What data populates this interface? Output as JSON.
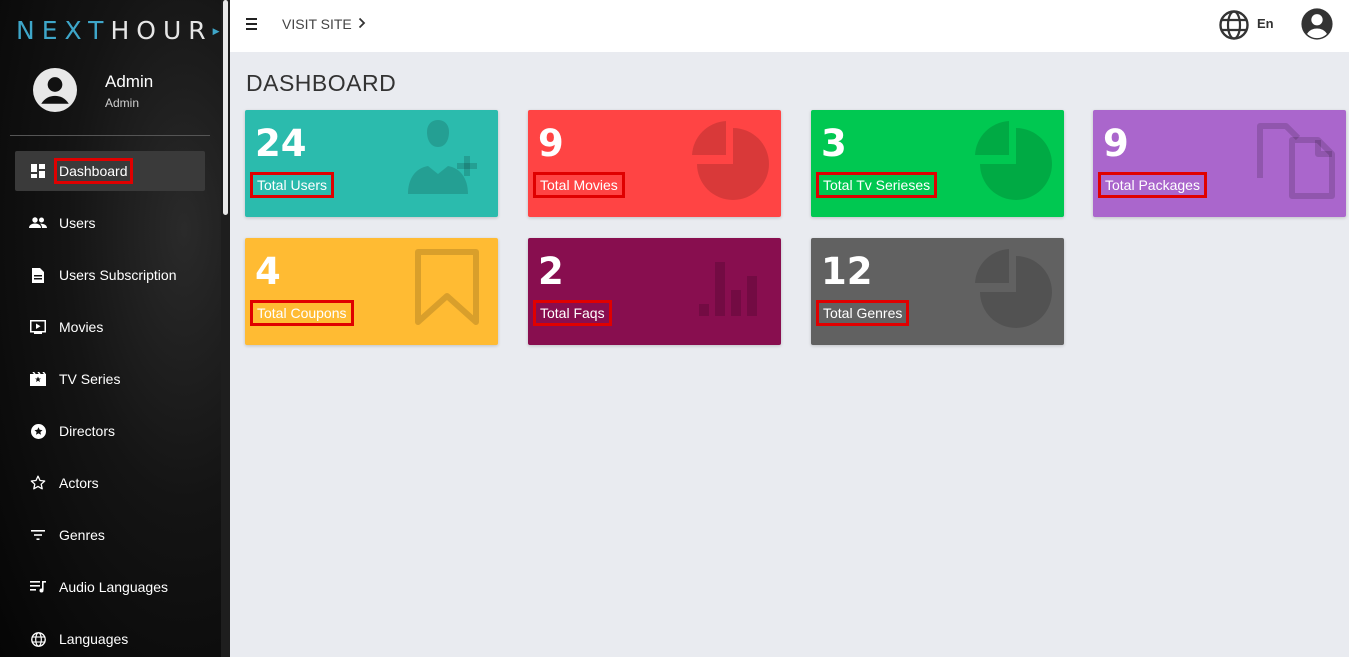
{
  "app": {
    "logo_left": "NEXT",
    "logo_right": "HOUR"
  },
  "profile": {
    "name": "Admin",
    "role": "Admin"
  },
  "sidebar": {
    "items": [
      {
        "label": "Dashboard",
        "icon": "dashboard-icon"
      },
      {
        "label": "Users",
        "icon": "users-icon"
      },
      {
        "label": "Users Subscription",
        "icon": "document-icon"
      },
      {
        "label": "Movies",
        "icon": "movie-icon"
      },
      {
        "label": "TV Series",
        "icon": "tv-series-icon"
      },
      {
        "label": "Directors",
        "icon": "director-star-icon"
      },
      {
        "label": "Actors",
        "icon": "star-outline-icon"
      },
      {
        "label": "Genres",
        "icon": "filter-icon"
      },
      {
        "label": "Audio Languages",
        "icon": "audio-list-icon"
      },
      {
        "label": "Languages",
        "icon": "globe-icon"
      }
    ]
  },
  "topbar": {
    "visit_site": "VISIT SITE",
    "language": "En"
  },
  "main": {
    "title": "DASHBOARD",
    "cards": [
      {
        "value": "24",
        "label": "Total Users",
        "color": "#2bbbad",
        "icon": "add-user-icon"
      },
      {
        "value": "9",
        "label": "Total Movies",
        "color": "#ff4444",
        "icon": "pie-chart-icon"
      },
      {
        "value": "3",
        "label": "Total Tv Serieses",
        "color": "#00c851",
        "icon": "pie-chart-icon"
      },
      {
        "value": "9",
        "label": "Total Packages",
        "color": "#aa66cc",
        "icon": "copy-icon"
      },
      {
        "value": "4",
        "label": "Total Coupons",
        "color": "#ffbb33",
        "icon": "bookmark-icon"
      },
      {
        "value": "2",
        "label": "Total Faqs",
        "color": "#880e4f",
        "icon": "bar-chart-icon"
      },
      {
        "value": "12",
        "label": "Total Genres",
        "color": "#616161",
        "icon": "pie-chart-icon"
      }
    ]
  }
}
